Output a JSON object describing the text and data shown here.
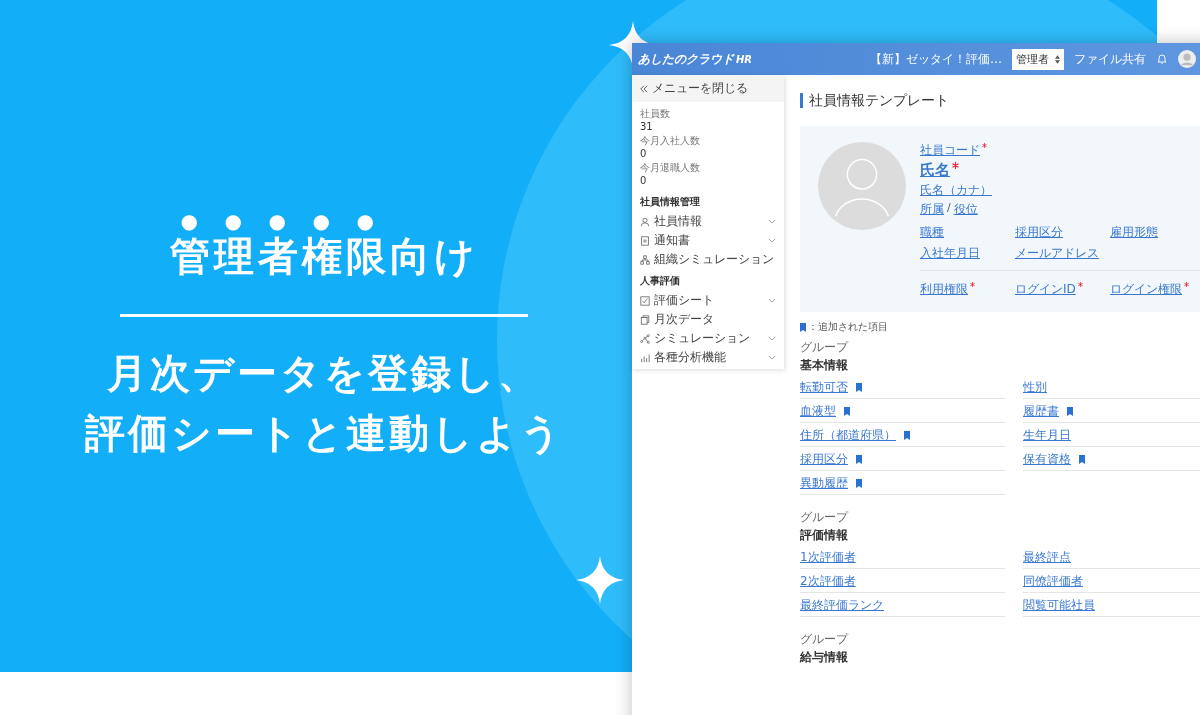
{
  "banner": {
    "heading_emphasized": "管理者権限",
    "heading_rest": "向け",
    "subtitle_lines": [
      "月次データを登録し、",
      "評価シートと連動しよう"
    ]
  },
  "app": {
    "logo": "あしたのクラウド",
    "logo_suffix": "HR",
    "header": {
      "notice": "【新】ゼッタイ！評価…",
      "role_select": "管理者",
      "file_share": "ファイル共有"
    },
    "sidebar": {
      "close_menu": "メニューを閉じる",
      "stats": [
        {
          "label": "社員数",
          "value": "31"
        },
        {
          "label": "今月入社人数",
          "value": "0"
        },
        {
          "label": "今月退職人数",
          "value": "0"
        }
      ],
      "sections": [
        {
          "title": "社員情報管理",
          "items": [
            {
              "label": "社員情報",
              "kind": "person",
              "expandable": true
            },
            {
              "label": "通知書",
              "kind": "document",
              "expandable": true
            },
            {
              "label": "組織シミュレーション",
              "kind": "org",
              "expandable": false
            }
          ]
        },
        {
          "title": "人事評価",
          "items": [
            {
              "label": "評価シート",
              "kind": "check",
              "expandable": true
            },
            {
              "label": "月次データ",
              "kind": "copy",
              "expandable": false
            },
            {
              "label": "シミュレーション",
              "kind": "nodes",
              "expandable": true
            },
            {
              "label": "各種分析機能",
              "kind": "bars",
              "expandable": true
            }
          ]
        }
      ]
    },
    "page_title": "社員情報テンプレート",
    "profile": {
      "code": {
        "label": "社員コード",
        "required": true
      },
      "name": {
        "label": "氏名",
        "required": true
      },
      "kana": "氏名（カナ）",
      "dept": "所属",
      "separator": "/",
      "position": "役位",
      "fields": [
        {
          "label": "職種",
          "required": false
        },
        {
          "label": "採用区分",
          "required": false
        },
        {
          "label": "雇用形態",
          "required": false
        },
        {
          "label": "入社年月日",
          "required": false
        },
        {
          "label": "メールアドレス",
          "required": false
        }
      ],
      "login_fields": [
        {
          "label": "利用権限",
          "required": true
        },
        {
          "label": "ログインID",
          "required": true
        },
        {
          "label": "ログイン権限",
          "required": true
        }
      ]
    },
    "legend": "：追加された項目",
    "groups": [
      {
        "caption": "グループ",
        "title": "基本情報",
        "items": [
          {
            "label": "転勤可否",
            "added": true
          },
          {
            "label": "性別",
            "added": false
          },
          {
            "label": "血液型",
            "added": true
          },
          {
            "label": "履歴書",
            "added": true
          },
          {
            "label": "住所（都道府県）",
            "added": true
          },
          {
            "label": "生年月日",
            "added": false
          },
          {
            "label": "採用区分",
            "added": true
          },
          {
            "label": "保有資格",
            "added": true
          },
          {
            "label": "異動履歴",
            "added": true
          }
        ]
      },
      {
        "caption": "グループ",
        "title": "評価情報",
        "items": [
          {
            "label": "1次評価者",
            "added": false
          },
          {
            "label": "最終評点",
            "added": false
          },
          {
            "label": "2次評価者",
            "added": false
          },
          {
            "label": "同僚評価者",
            "added": false
          },
          {
            "label": "最終評価ランク",
            "added": false
          },
          {
            "label": "閲覧可能社員",
            "added": false
          }
        ]
      },
      {
        "caption": "グループ",
        "title": "給与情報"
      }
    ]
  }
}
